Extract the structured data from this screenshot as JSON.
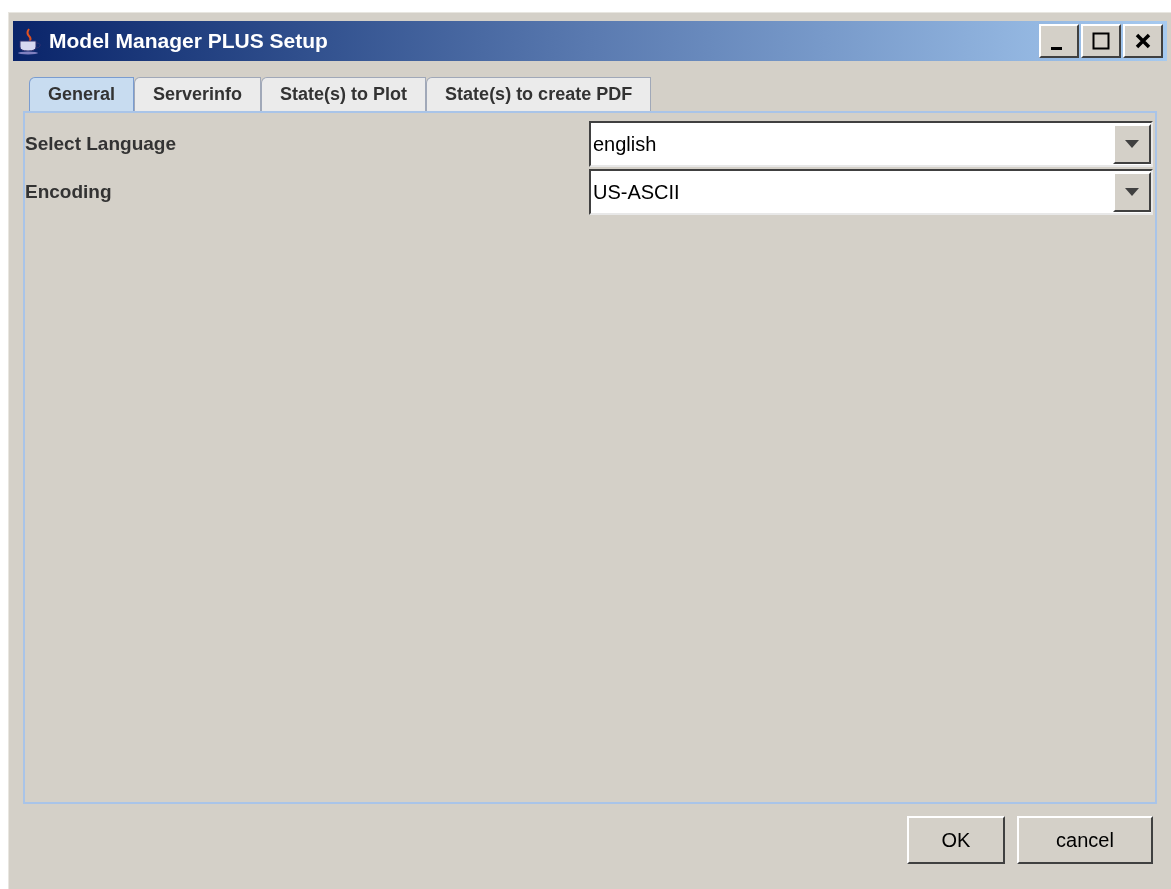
{
  "window": {
    "title": "Model Manager PLUS Setup"
  },
  "tabs": [
    {
      "label": "General",
      "selected": true
    },
    {
      "label": "Serverinfo",
      "selected": false
    },
    {
      "label": "State(s) to Plot",
      "selected": false
    },
    {
      "label": "State(s) to create PDF",
      "selected": false
    }
  ],
  "settings": [
    {
      "label": "Select Language",
      "value": "english"
    },
    {
      "label": "Encoding",
      "value": "US-ASCII"
    }
  ],
  "buttons": [
    "OK",
    "cancel"
  ]
}
